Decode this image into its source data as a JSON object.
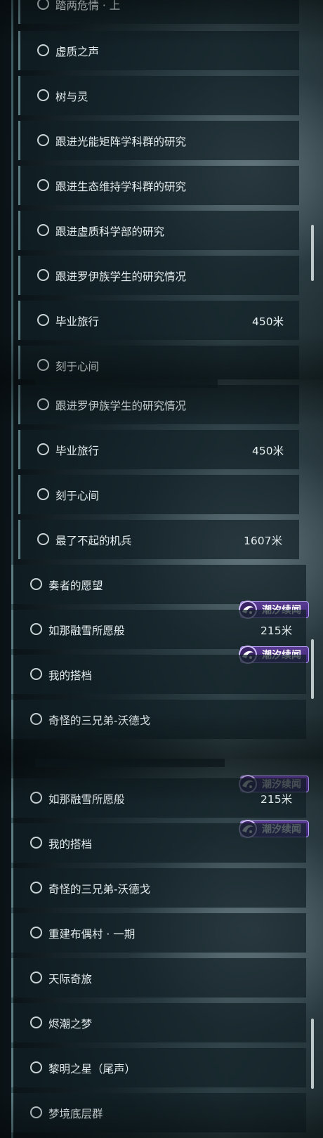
{
  "distance_unit": "米",
  "badge_label": "潮汐续闻",
  "panels": [
    {
      "rows": [
        {
          "label": "踏两危情 · 上",
          "distance": ""
        },
        {
          "label": "虚质之声",
          "distance": ""
        },
        {
          "label": "树与灵",
          "distance": ""
        },
        {
          "label": "跟进光能矩阵学科群的研究",
          "distance": ""
        },
        {
          "label": "跟进生态维持学科群的研究",
          "distance": ""
        },
        {
          "label": "跟进虚质科学部的研究",
          "distance": ""
        },
        {
          "label": "跟进罗伊族学生的研究情况",
          "distance": ""
        },
        {
          "label": "毕业旅行",
          "distance": "450米"
        },
        {
          "label": "刻于心间",
          "distance": ""
        }
      ]
    },
    {
      "rows": [
        {
          "label": "跟进罗伊族学生的研究情况",
          "distance": ""
        },
        {
          "label": "毕业旅行",
          "distance": "450米"
        },
        {
          "label": "刻于心间",
          "distance": ""
        },
        {
          "label": "最了不起的机兵",
          "distance": "1607米"
        },
        {
          "label": "奏者的愿望",
          "distance": ""
        },
        {
          "label": "如那融雪所愿般",
          "distance": "215米"
        },
        {
          "label": "我的搭档",
          "distance": ""
        },
        {
          "label": "奇怪的三兄弟-沃德戈",
          "distance": ""
        }
      ]
    },
    {
      "rows": [
        {
          "label": "如那融雪所愿般",
          "distance": "215米"
        },
        {
          "label": "我的搭档",
          "distance": ""
        },
        {
          "label": "奇怪的三兄弟-沃德戈",
          "distance": ""
        },
        {
          "label": "重建布偶村 · 一期",
          "distance": ""
        },
        {
          "label": "天际奇旅",
          "distance": ""
        },
        {
          "label": "烬潮之梦",
          "distance": ""
        },
        {
          "label": "黎明之星（尾声）",
          "distance": ""
        },
        {
          "label": "梦境底层群",
          "distance": ""
        }
      ]
    }
  ]
}
